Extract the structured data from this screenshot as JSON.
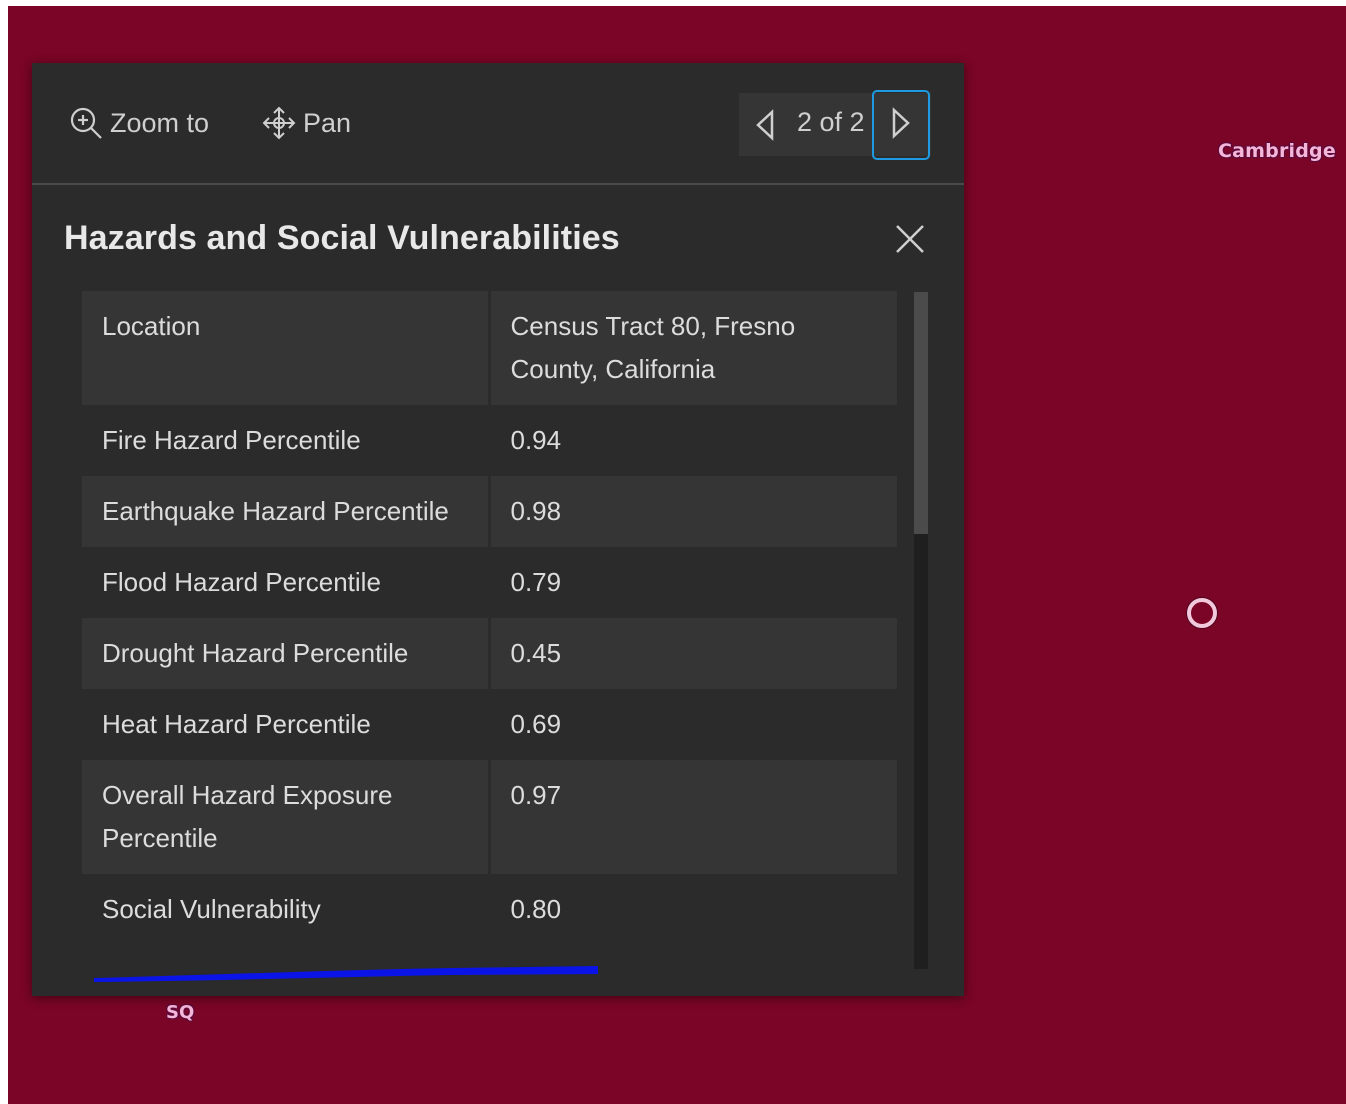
{
  "map": {
    "label_top_right": "Cambridge",
    "label_bottom": "SQ",
    "background_color": "#7a0526"
  },
  "popup": {
    "actions": [
      {
        "label": "Zoom to",
        "icon": "zoom-in-icon"
      },
      {
        "label": "Pan",
        "icon": "pan-icon"
      }
    ],
    "pager": {
      "text": "2 of 2",
      "prev_icon": "chevron-left-icon",
      "next_icon": "chevron-right-icon"
    },
    "title": "Hazards and Social Vulnerabilities",
    "close_icon": "close-icon",
    "rows": [
      {
        "key": "Location",
        "value": "Census Tract 80, Fresno County, California"
      },
      {
        "key": "Fire Hazard Percentile",
        "value": "0.94"
      },
      {
        "key": "Earthquake Hazard Percentile",
        "value": "0.98"
      },
      {
        "key": "Flood Hazard Percentile",
        "value": "0.79"
      },
      {
        "key": "Drought Hazard Percentile",
        "value": "0.45"
      },
      {
        "key": "Heat Hazard Percentile",
        "value": "0.69"
      },
      {
        "key": "Overall Hazard Exposure Percentile",
        "value": "0.97"
      },
      {
        "key": "Social Vulnerability",
        "value": "0.80"
      }
    ],
    "focus_color": "#1e9be0",
    "annotation_color": "#0a14e6"
  }
}
